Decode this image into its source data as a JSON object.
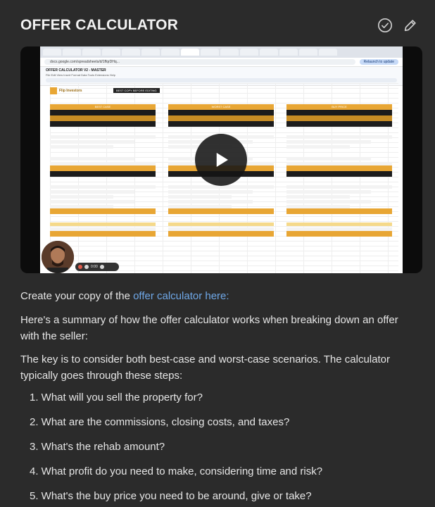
{
  "header": {
    "title": "OFFER CALCULATOR",
    "check_icon": "check-circle-icon",
    "edit_icon": "pencil-icon"
  },
  "video": {
    "browser_url": "docs.google.com/spreadsheets/d/1ffqrDHq...",
    "doc_name": "OFFER CALCULATOR V2 - MASTER",
    "menus": "File  Edit  View  Insert  Format  Data  Tools  Extensions  Help",
    "share_pill": "Relaunch to update",
    "logo_text": "Flip Investors",
    "sheet_title": "BEST COPY BEFORE EDITING",
    "col1_title": "BEST CASE",
    "col2_title": "WORST CASE",
    "col3_title": "BUY PRICE",
    "play_icon": "play-icon",
    "time_display": "0:00"
  },
  "body": {
    "copy_prefix": "Create your copy of the ",
    "copy_link": "offer calculator here:",
    "summary": "Here's a summary of how the offer calculator works when breaking down an offer with the seller:",
    "key": "The key is to consider both best-case and worst-case scenarios. The calculator typically goes through these steps:",
    "steps": [
      "1. What will you sell the property for?",
      "2. What are the commissions, closing costs, and taxes?",
      "3. What's the rehab amount?",
      "4. What profit do you need to make, considering time and risk?",
      "5. What's the buy price you need to be around, give or take?"
    ]
  },
  "colors": {
    "background": "#2b2b2b",
    "link": "#6fa8e8",
    "sheet_accent": "#e8a634"
  }
}
